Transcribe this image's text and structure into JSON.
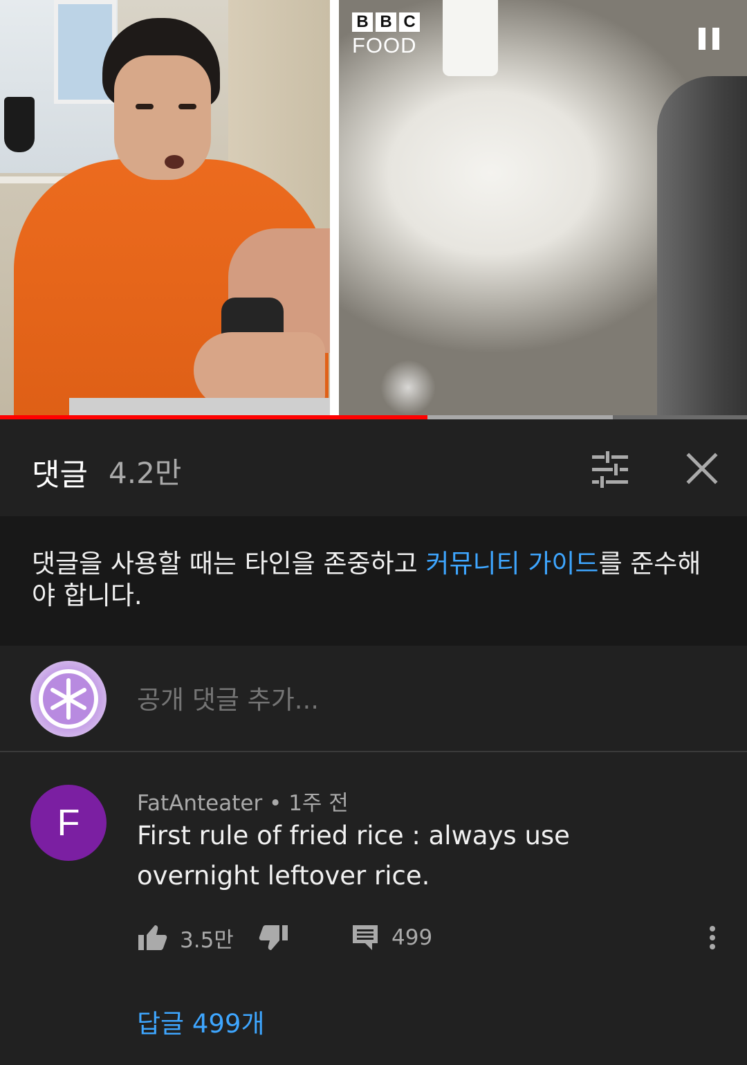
{
  "video": {
    "overlay_logo_top": [
      "B",
      "B",
      "C"
    ],
    "overlay_logo_bottom": "FOOD",
    "progress": {
      "played_fraction": 0.572,
      "buffered_fraction": 0.82
    },
    "colors": {
      "played": "#ff0000",
      "buffered": "#a9a9a9",
      "track": "#6b6b6b"
    }
  },
  "comments_header": {
    "title": "댓글",
    "count": "4.2만"
  },
  "notice": {
    "before": "댓글을 사용할 때는 타인을 존중하고 ",
    "link": "커뮤니티 가이드",
    "after": "를 준수해야 합니다."
  },
  "add_comment": {
    "placeholder": "공개 댓글 추가..."
  },
  "comment": {
    "avatar_letter": "F",
    "author": "FatAnteater",
    "separator": " • ",
    "time": "1주 전",
    "text": "First rule of fried rice : always use overnight leftover rice.",
    "likes": "3.5만",
    "reply_count": "499",
    "replies_link": "답글 499개"
  },
  "icons": {
    "pause": "pause-icon",
    "filter": "sort-filter-icon",
    "close": "close-icon",
    "like": "thumbs-up-icon",
    "dislike": "thumbs-down-icon",
    "reply": "comment-icon",
    "more": "more-vertical-icon"
  },
  "colors": {
    "background": "#212121",
    "notice_background": "#181818",
    "link": "#3ea6ff",
    "secondary_text": "#aaaaaa",
    "author_avatar": "#7b1fa2"
  }
}
